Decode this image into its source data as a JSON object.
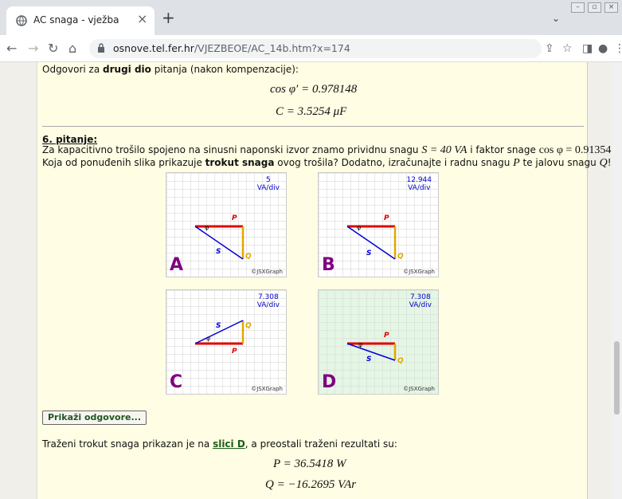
{
  "browser": {
    "tab_title": "AC snaga - vježba",
    "new_tab": "+",
    "url_host": "osnove.tel.fer.hr",
    "url_path": "/VJEZBEOE/AC_14b.htm?x=174"
  },
  "page": {
    "intro_text_pre": "Odgovori za ",
    "intro_text_bold": "drugi dio",
    "intro_text_post": " pitanja (nakon kompenzacije):",
    "eq_cos": "cos φ′ = 0.978148",
    "eq_c": "C = 3.5254 μF",
    "question_heading": "6. pitanje:",
    "question_line1_a": "Za kapacitivno trošilo spojeno na sinusni naponski izvor znamo prividnu snagu ",
    "question_line1_s": "S = 40 VA",
    "question_line1_b": " i faktor snage ",
    "question_line1_pf": "cos φ = 0.913545",
    "question_line1_end": ".",
    "question_line2_a": "Koja od ponuđenih slika prikazuje ",
    "question_line2_bold": "trokut snaga",
    "question_line2_b": " ovog trošila? Dodatno, izračunajte i radnu snagu ",
    "question_line2_p": "P",
    "question_line2_c": " te jalovu snagu ",
    "question_line2_q": "Q",
    "question_line2_end": "!",
    "panels": [
      {
        "letter": "A",
        "scale_value": "5",
        "scale_unit": "VA/div",
        "credit": "©JSXGraph"
      },
      {
        "letter": "B",
        "scale_value": "12.944",
        "scale_unit": "VA/div",
        "credit": "©JSXGraph"
      },
      {
        "letter": "C",
        "scale_value": "7.308",
        "scale_unit": "VA/div",
        "credit": "©JSXGraph"
      },
      {
        "letter": "D",
        "scale_value": "7.308",
        "scale_unit": "VA/div",
        "credit": "©JSXGraph"
      }
    ],
    "vector_labels": {
      "p": "P",
      "q": "Q",
      "s": "S",
      "phi": "φ"
    },
    "show_answers_button": "Prikaži odgovore...",
    "answer_pre": "Traženi trokut snaga prikazan je na ",
    "answer_link": "slici D",
    "answer_post": ", a preostali traženi rezultati su:",
    "eq_p": "P = 36.5418 W",
    "eq_q": "Q = −16.2695 VAr"
  },
  "colors": {
    "p_vector": "#e00000",
    "q_vector": "#e0a800",
    "s_vector": "#0000dd",
    "selected_bg": "#e4f6e4"
  }
}
